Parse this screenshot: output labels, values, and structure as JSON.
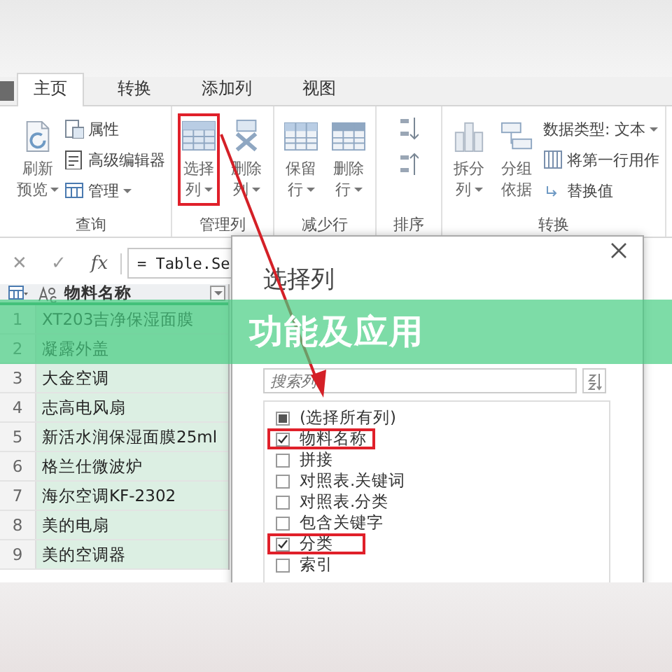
{
  "tabs": [
    {
      "label": "主页",
      "selected": true
    },
    {
      "label": "转换",
      "selected": false
    },
    {
      "label": "添加列",
      "selected": false
    },
    {
      "label": "视图",
      "selected": false
    }
  ],
  "ribbon": {
    "groups": [
      {
        "label": "查询",
        "items": [
          {
            "kind": "large",
            "lines": [
              "刷新",
              "预览"
            ],
            "dropdown": true,
            "highlighted": false
          },
          {
            "kind": "stack",
            "entries": [
              {
                "label": "属性",
                "dropdown": false
              },
              {
                "label": "高级编辑器",
                "dropdown": false
              },
              {
                "label": "管理",
                "dropdown": true
              }
            ]
          }
        ]
      },
      {
        "label": "管理列",
        "items": [
          {
            "kind": "large",
            "lines": [
              "选择",
              "列"
            ],
            "dropdown": true,
            "highlighted": true
          },
          {
            "kind": "large",
            "lines": [
              "删除",
              "列"
            ],
            "dropdown": true,
            "highlighted": false
          }
        ]
      },
      {
        "label": "减少行",
        "items": [
          {
            "kind": "large",
            "lines": [
              "保留",
              "行"
            ],
            "dropdown": true,
            "highlighted": false
          },
          {
            "kind": "large",
            "lines": [
              "删除",
              "行"
            ],
            "dropdown": true,
            "highlighted": false
          }
        ]
      },
      {
        "label": "排序",
        "items": [
          {
            "kind": "sort"
          }
        ]
      },
      {
        "label": "转换",
        "items": [
          {
            "kind": "large",
            "lines": [
              "拆分",
              "列"
            ],
            "dropdown": true,
            "highlighted": false
          },
          {
            "kind": "large",
            "lines": [
              "分组",
              "依据"
            ],
            "dropdown": false,
            "highlighted": false
          },
          {
            "kind": "stack",
            "entries": [
              {
                "label": "数据类型: 文本",
                "dropdown": true
              },
              {
                "label": "将第一行用作",
                "dropdown": false
              },
              {
                "label": "替换值",
                "dropdown": false
              }
            ]
          }
        ]
      }
    ]
  },
  "formula_bar": {
    "cancel": "✕",
    "confirm": "✓",
    "fx": "fx",
    "formula": "= Table.Se"
  },
  "table": {
    "column": "物料名称",
    "rows": [
      {
        "index": "1",
        "name": "XT203吉净保湿面膜"
      },
      {
        "index": "2",
        "name": "凝露外盖"
      },
      {
        "index": "3",
        "name": "大金空调"
      },
      {
        "index": "4",
        "name": "志高电风扇"
      },
      {
        "index": "5",
        "name": "新活水润保湿面膜25ml"
      },
      {
        "index": "6",
        "name": "格兰仕微波炉"
      },
      {
        "index": "7",
        "name": "海尔空调KF-2302"
      },
      {
        "index": "8",
        "name": "美的电扇"
      },
      {
        "index": "9",
        "name": "美的空调器"
      }
    ]
  },
  "dialog": {
    "title": "选择列",
    "search": {
      "placeholder": "搜索列"
    },
    "items": [
      {
        "kind": "select_all",
        "label": "(选择所有列)",
        "checked": false,
        "highlighted": false
      },
      {
        "kind": "column",
        "label": "物料名称",
        "checked": true,
        "highlighted": true
      },
      {
        "kind": "column",
        "label": "拼接",
        "checked": false,
        "highlighted": false
      },
      {
        "kind": "column",
        "label": "对照表.关键词",
        "checked": false,
        "highlighted": false
      },
      {
        "kind": "column",
        "label": "对照表.分类",
        "checked": false,
        "highlighted": false
      },
      {
        "kind": "column",
        "label": "包含关键字",
        "checked": false,
        "highlighted": false
      },
      {
        "kind": "column",
        "label": "分类",
        "checked": true,
        "highlighted": true
      },
      {
        "kind": "column",
        "label": "索引",
        "checked": false,
        "highlighted": false
      }
    ]
  },
  "banner": {
    "text": "功能及应用"
  }
}
